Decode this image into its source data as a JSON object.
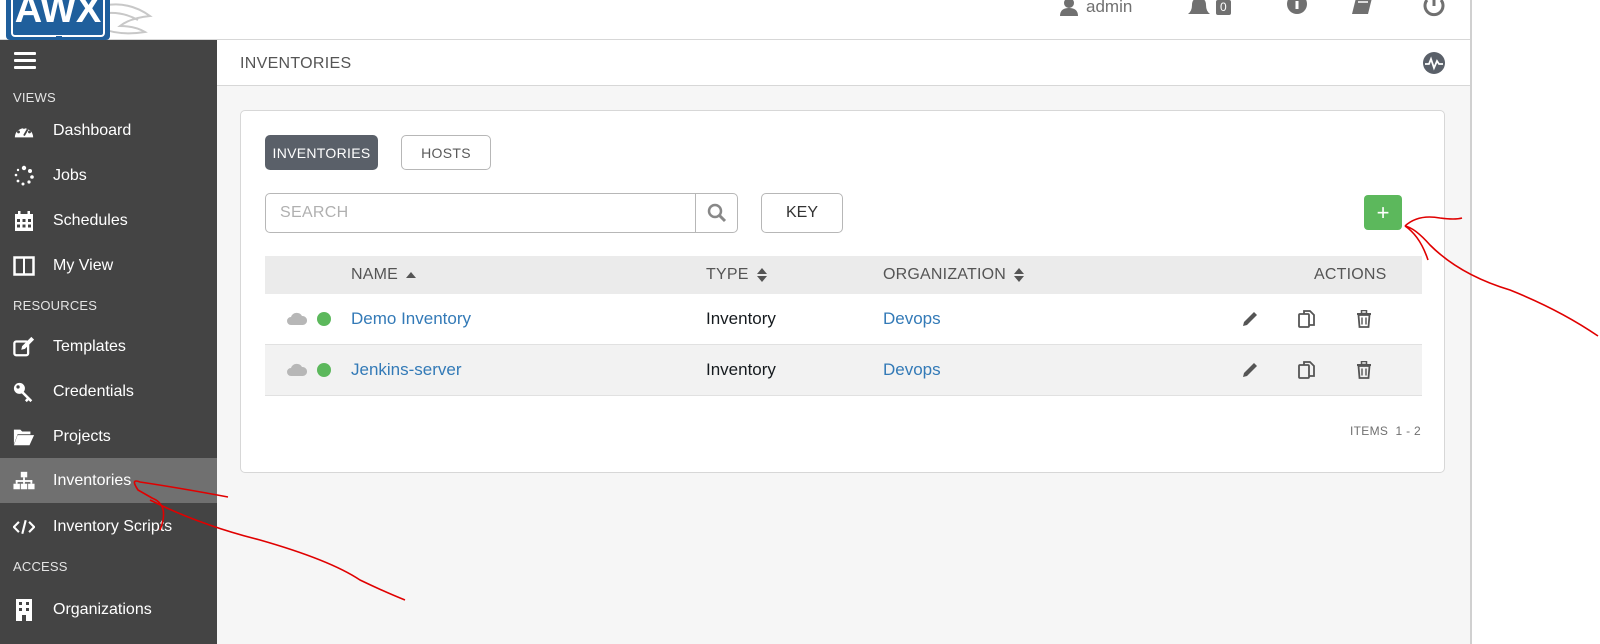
{
  "header": {
    "logo_text": "AWX",
    "user_label": "admin",
    "notification_count": "0"
  },
  "sidebar": {
    "sections": {
      "views": "VIEWS",
      "resources": "RESOURCES",
      "access": "ACCESS"
    },
    "items": [
      {
        "label": "Dashboard",
        "icon": "dashboard-icon"
      },
      {
        "label": "Jobs",
        "icon": "jobs-icon"
      },
      {
        "label": "Schedules",
        "icon": "calendar-icon"
      },
      {
        "label": "My View",
        "icon": "columns-icon"
      },
      {
        "label": "Templates",
        "icon": "edit-icon"
      },
      {
        "label": "Credentials",
        "icon": "key-icon"
      },
      {
        "label": "Projects",
        "icon": "folder-icon"
      },
      {
        "label": "Inventories",
        "icon": "sitemap-icon",
        "active": true
      },
      {
        "label": "Inventory Scripts",
        "icon": "code-icon"
      },
      {
        "label": "Organizations",
        "icon": "building-icon"
      }
    ]
  },
  "page": {
    "breadcrumb": "INVENTORIES"
  },
  "tabs": {
    "inventories": "INVENTORIES",
    "hosts": "HOSTS"
  },
  "search": {
    "placeholder": "SEARCH",
    "key_label": "KEY",
    "add_label": "+"
  },
  "table": {
    "headers": {
      "name": "NAME",
      "type": "TYPE",
      "organization": "ORGANIZATION",
      "actions": "ACTIONS"
    },
    "rows": [
      {
        "name": "Demo Inventory",
        "type": "Inventory",
        "organization": "Devops"
      },
      {
        "name": "Jenkins-server",
        "type": "Inventory",
        "organization": "Devops"
      }
    ],
    "items_label": "ITEMS",
    "items_range": "1 - 2"
  },
  "colors": {
    "sidebar": "#444444",
    "sidebar_active": "#707070",
    "link": "#337ab7",
    "success": "#5cb85c",
    "annotation": "#e00000"
  }
}
